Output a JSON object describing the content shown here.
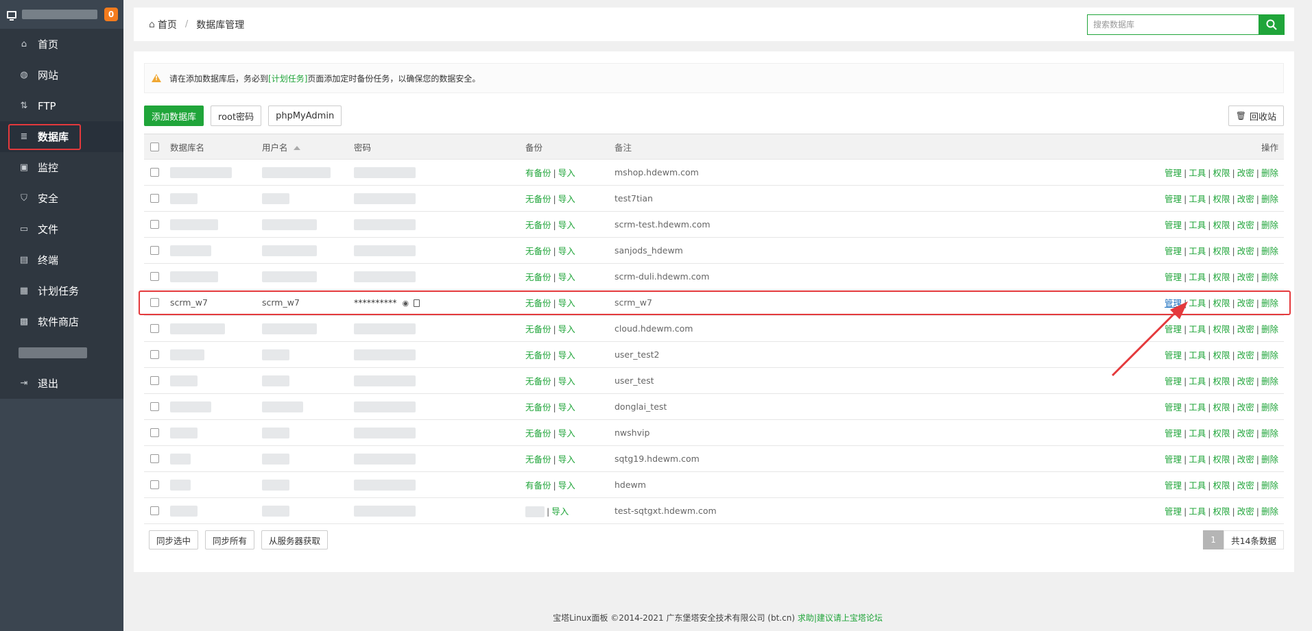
{
  "sidebar": {
    "badge": "0",
    "items": [
      {
        "label": "首页",
        "icon": "home-icon"
      },
      {
        "label": "网站",
        "icon": "globe-icon"
      },
      {
        "label": "FTP",
        "icon": "ftp-icon"
      },
      {
        "label": "数据库",
        "icon": "database-icon"
      },
      {
        "label": "监控",
        "icon": "monitor-icon"
      },
      {
        "label": "安全",
        "icon": "shield-icon"
      },
      {
        "label": "文件",
        "icon": "folder-icon"
      },
      {
        "label": "终端",
        "icon": "terminal-icon"
      },
      {
        "label": "计划任务",
        "icon": "calendar-icon"
      },
      {
        "label": "软件商店",
        "icon": "apps-icon"
      },
      {
        "label": "退出",
        "icon": "logout-icon"
      }
    ]
  },
  "breadcrumb": {
    "home": "首页",
    "current": "数据库管理"
  },
  "search": {
    "placeholder": "搜索数据库"
  },
  "warning": {
    "pre": "请在添加数据库后，务必到",
    "link": "[计划任务]",
    "post": "页面添加定时备份任务，以确保您的数据安全。"
  },
  "toolbar": {
    "add": "添加数据库",
    "root_pw": "root密码",
    "phpmyadmin": "phpMyAdmin",
    "recycle": "回收站"
  },
  "table": {
    "headers": {
      "name": "数据库名",
      "user": "用户名",
      "password": "密码",
      "backup": "备份",
      "note": "备注",
      "ops": "操作"
    },
    "import_label": "导入",
    "ops": [
      "管理",
      "工具",
      "权限",
      "改密",
      "删除"
    ],
    "rows": [
      {
        "name": "",
        "user": "",
        "backup": "有备份",
        "note": "mshop.hdewm.com"
      },
      {
        "name": "",
        "user": "",
        "backup": "无备份",
        "note": "test7tian"
      },
      {
        "name": "",
        "user": "",
        "backup": "无备份",
        "note": "scrm-test.hdewm.com"
      },
      {
        "name": "",
        "user": "",
        "backup": "无备份",
        "note": "sanjods_hdewm"
      },
      {
        "name": "",
        "user": "",
        "backup": "无备份",
        "note": "scrm-duli.hdewm.com"
      },
      {
        "name": "scrm_w7",
        "user": "scrm_w7",
        "password": "**********",
        "backup": "无备份",
        "note": "scrm_w7"
      },
      {
        "name": "",
        "user": "",
        "backup": "无备份",
        "note": "cloud.hdewm.com"
      },
      {
        "name": "",
        "user": "",
        "backup": "无备份",
        "note": "user_test2"
      },
      {
        "name": "",
        "user": "",
        "backup": "无备份",
        "note": "user_test"
      },
      {
        "name": "",
        "user": "",
        "backup": "无备份",
        "note": "donglai_test"
      },
      {
        "name": "",
        "user": "",
        "backup": "无备份",
        "note": "nwshvip"
      },
      {
        "name": "",
        "user": "",
        "backup": "无备份",
        "note": "sqtg19.hdewm.com"
      },
      {
        "name": "",
        "user": "",
        "backup": "有备份",
        "note": "hdewm"
      },
      {
        "name": "",
        "user": "",
        "backup": "",
        "note": "test-sqtgxt.hdewm.com"
      }
    ]
  },
  "bottom": {
    "sync_selected": "同步选中",
    "sync_all": "同步所有",
    "fetch": "从服务器获取"
  },
  "pager": {
    "page": "1",
    "total": "共14条数据"
  },
  "footer": {
    "copyright": "宝塔Linux面板 ©2014-2021 广东堡塔安全技术有限公司 (bt.cn)",
    "help": "求助|建议请上宝塔论坛"
  },
  "colors": {
    "accent": "#20a53a",
    "sidebar": "#2f3740",
    "highlight": "#e4393c"
  }
}
